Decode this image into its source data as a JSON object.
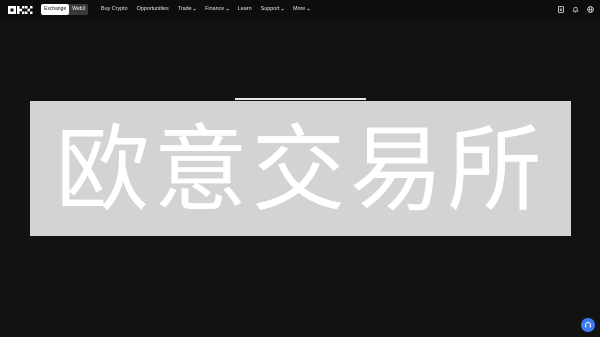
{
  "header": {
    "logo_icon": "okx-logo-icon",
    "switcher": {
      "exchange_label": "Exchange",
      "wallet_label": "Web3"
    },
    "nav": [
      {
        "label": "Buy Crypto",
        "has_menu": false
      },
      {
        "label": "Opportunities",
        "has_menu": false
      },
      {
        "label": "Trade",
        "has_menu": true
      },
      {
        "label": "Finance",
        "has_menu": true
      },
      {
        "label": "Learn",
        "has_menu": false
      },
      {
        "label": "Support",
        "has_menu": true
      },
      {
        "label": "More",
        "has_menu": true
      }
    ],
    "right_icons": [
      "download-icon",
      "bell-icon",
      "globe-icon"
    ]
  },
  "hero": {
    "title": "欧意交易所"
  },
  "support_button": {
    "icon": "headset-icon",
    "color": "#3e7af3"
  },
  "colors": {
    "background": "#121212",
    "hero_panel": "#d3d3d3",
    "accent": "#3e7af3"
  }
}
